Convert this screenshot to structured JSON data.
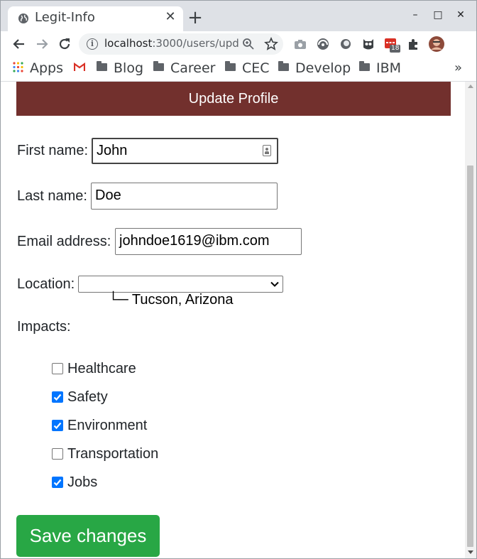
{
  "browser": {
    "tab_title": "Legit-Info",
    "tab_close": "✕",
    "new_tab": "+",
    "window_controls": {
      "minimize": "–",
      "maximize": "□",
      "close": "✕"
    },
    "url_host": "localhost",
    "url_rest": ":3000/users/upd...",
    "extension_badge": "18",
    "bookmarks": [
      {
        "label": "Apps",
        "icon": "apps-grid-icon"
      },
      {
        "label": "",
        "icon": "gmail-icon"
      },
      {
        "label": "Blog",
        "icon": "folder-icon"
      },
      {
        "label": "Career",
        "icon": "folder-icon"
      },
      {
        "label": "CEC",
        "icon": "folder-icon"
      },
      {
        "label": "Develop",
        "icon": "folder-icon"
      },
      {
        "label": "IBM",
        "icon": "folder-icon"
      }
    ],
    "bookmarks_overflow": "»"
  },
  "page": {
    "header": "Update Profile",
    "header_color": "#72302d",
    "first_name_label": "First name:",
    "first_name_value": "John",
    "last_name_label": "Last name:",
    "last_name_value": "Doe",
    "email_label": "Email address:",
    "email_value": "johndoe1619@ibm.com",
    "location_label": "Location:",
    "location_value": "└─ Tucson, Arizona",
    "impacts_label": "Impacts:",
    "impacts": [
      {
        "label": "Healthcare",
        "checked": false
      },
      {
        "label": "Safety",
        "checked": true
      },
      {
        "label": "Environment",
        "checked": true
      },
      {
        "label": "Transportation",
        "checked": false
      },
      {
        "label": "Jobs",
        "checked": true
      }
    ],
    "save_label": "Save changes",
    "save_color": "#28a745",
    "checkbox_color": "#0075ff"
  }
}
